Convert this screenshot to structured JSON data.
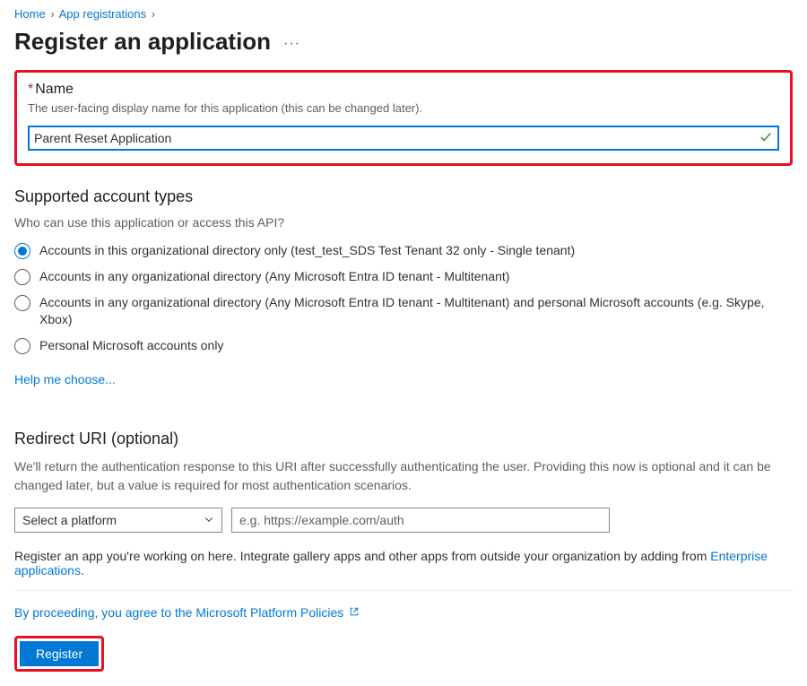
{
  "breadcrumb": {
    "items": [
      "Home",
      "App registrations"
    ]
  },
  "page": {
    "title": "Register an application"
  },
  "name_section": {
    "label": "Name",
    "description": "The user-facing display name for this application (this can be changed later).",
    "value": "Parent Reset Application"
  },
  "account_types": {
    "title": "Supported account types",
    "question": "Who can use this application or access this API?",
    "options": [
      {
        "label": "Accounts in this organizational directory only (test_test_SDS Test Tenant 32 only - Single tenant)",
        "selected": true
      },
      {
        "label": "Accounts in any organizational directory (Any Microsoft Entra ID tenant - Multitenant)",
        "selected": false
      },
      {
        "label": "Accounts in any organizational directory (Any Microsoft Entra ID tenant - Multitenant) and personal Microsoft accounts (e.g. Skype, Xbox)",
        "selected": false
      },
      {
        "label": "Personal Microsoft accounts only",
        "selected": false
      }
    ],
    "help_link": "Help me choose..."
  },
  "redirect": {
    "title": "Redirect URI (optional)",
    "description": "We'll return the authentication response to this URI after successfully authenticating the user. Providing this now is optional and it can be changed later, but a value is required for most authentication scenarios.",
    "platform_placeholder": "Select a platform",
    "uri_placeholder": "e.g. https://example.com/auth"
  },
  "integrate_note": {
    "prefix": "Register an app you're working on here. Integrate gallery apps and other apps from outside your organization by adding from ",
    "link": "Enterprise applications",
    "suffix": "."
  },
  "footer": {
    "consent_prefix": "By proceeding, you agree to the ",
    "consent_link": "Microsoft Platform Policies",
    "register_label": "Register"
  }
}
